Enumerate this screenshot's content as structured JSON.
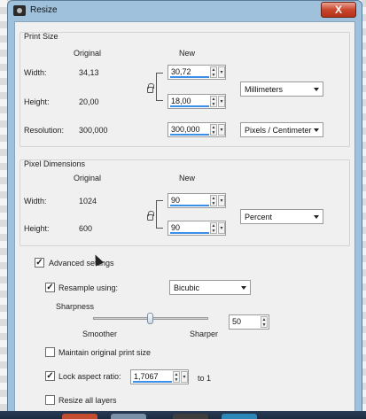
{
  "window": {
    "title": "Resize",
    "close_label": "X"
  },
  "print_size": {
    "group_label": "Print Size",
    "col_original": "Original",
    "col_new": "New",
    "width_label": "Width:",
    "width_original": "34,13",
    "width_new": "30,72",
    "height_label": "Height:",
    "height_original": "20,00",
    "height_new": "18,00",
    "units": "Millimeters",
    "resolution_label": "Resolution:",
    "resolution_original": "300,000",
    "resolution_new": "300,000",
    "resolution_units": "Pixels / Centimeter"
  },
  "pixel_dimensions": {
    "group_label": "Pixel Dimensions",
    "col_original": "Original",
    "col_new": "New",
    "width_label": "Width:",
    "width_original": "1024",
    "width_new": "90",
    "height_label": "Height:",
    "height_original": "600",
    "height_new": "90",
    "units": "Percent"
  },
  "advanced": {
    "label": "Advanced settings",
    "checked": true,
    "resample_label": "Resample using:",
    "resample_checked": true,
    "resample_method": "Bicubic",
    "sharpness_label": "Sharpness",
    "smoother_label": "Smoother",
    "sharper_label": "Sharper",
    "sharpness_value": "50",
    "sharpness_fraction": 0.5,
    "maintain_label": "Maintain original print size",
    "maintain_checked": false,
    "lock_aspect_label": "Lock aspect ratio:",
    "lock_aspect_checked": true,
    "aspect_value": "1,7067",
    "aspect_suffix": "to 1",
    "resize_all_label": "Resize all layers",
    "resize_all_checked": false
  },
  "icons": {
    "app": "camera-icon",
    "lock": "chain-link-icon",
    "spin": "spin-arrows-icon",
    "dropdown": "chevron-down-icon",
    "cursor": "mouse-pointer-icon"
  },
  "colors": {
    "window_frame": "#9fc1dc",
    "close_button": "#c9452d",
    "client_bg": "#f0f0f0",
    "field_underline": "#3a8ee6"
  }
}
